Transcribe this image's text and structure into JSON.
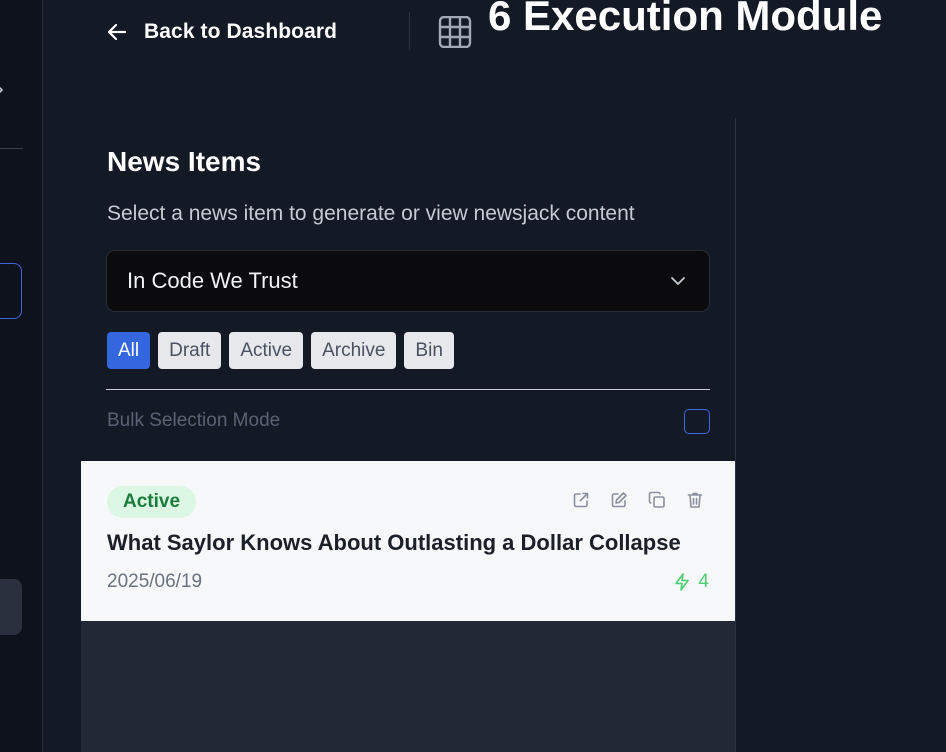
{
  "header": {
    "back_label": "Back to Dashboard",
    "module_title": "6 Execution Module"
  },
  "panel": {
    "title": "News Items",
    "subtitle": "Select a news item to generate or view newsjack content",
    "select": {
      "value": "In Code We Trust"
    },
    "filters": [
      {
        "label": "All",
        "active": true
      },
      {
        "label": "Draft",
        "active": false
      },
      {
        "label": "Active",
        "active": false
      },
      {
        "label": "Archive",
        "active": false
      },
      {
        "label": "Bin",
        "active": false
      }
    ],
    "bulk_label": "Bulk Selection Mode"
  },
  "news_items": [
    {
      "status": "Active",
      "title": "What Saylor Knows About Outlasting a Dollar Collapse",
      "date": "2025/06/19",
      "count": "4",
      "actions": [
        "external-link-icon",
        "edit-icon",
        "copy-icon",
        "trash-icon"
      ]
    }
  ],
  "colors": {
    "background": "#141926",
    "accent": "#3466e0",
    "status_active_bg": "#dcf7e3",
    "status_active_text": "#1c7c3d",
    "count_green": "#4ccf73"
  }
}
